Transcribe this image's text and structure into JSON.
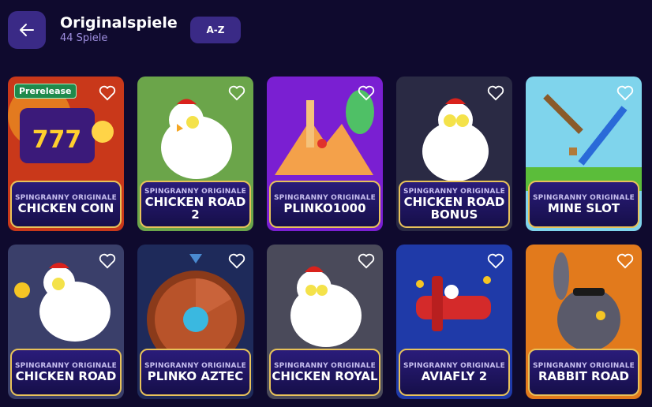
{
  "header": {
    "title": "Originalspiele",
    "count": "44 Spiele",
    "sort_label": "A-Z"
  },
  "games": [
    {
      "sub": "SPINGRANNY ORIGINALE",
      "name": "CHICKEN COIN",
      "badge": "Prerelease",
      "bg": "#d8461d"
    },
    {
      "sub": "SPINGRANNY ORIGINALE",
      "name": "CHICKEN ROAD 2",
      "bg": "#6ba54a"
    },
    {
      "sub": "SPINGRANNY ORIGINALE",
      "name": "PLINKO1000",
      "bg": "#7a1fd2"
    },
    {
      "sub": "SPINGRANNY ORIGINALE",
      "name": "CHICKEN ROAD BONUS",
      "bg": "#2a2a44"
    },
    {
      "sub": "SPINGRANNY ORIGINALE",
      "name": "MINE SLOT",
      "bg": "#7fd4ec"
    },
    {
      "sub": "SPINGRANNY ORIGINALE",
      "name": "CHICKEN ROAD",
      "bg": "#3a3f6a"
    },
    {
      "sub": "SPINGRANNY ORIGINALE",
      "name": "PLINKO AZTEC",
      "bg": "#1e2a5a"
    },
    {
      "sub": "SPINGRANNY ORIGINALE",
      "name": "CHICKEN ROYAL",
      "bg": "#4a4a5a"
    },
    {
      "sub": "SPINGRANNY ORIGINALE",
      "name": "AVIAFLY 2",
      "bg": "#1f3aa8"
    },
    {
      "sub": "SPINGRANNY ORIGINALE",
      "name": "RABBIT ROAD",
      "bg": "#e27a1c"
    }
  ],
  "icons": {
    "back": "arrow-left-icon",
    "favorite": "heart-icon"
  },
  "colors": {
    "background": "#0f0a2e",
    "button": "#3a2a86",
    "label_border": "#e8c25a",
    "badge": "#1f8a4c"
  }
}
